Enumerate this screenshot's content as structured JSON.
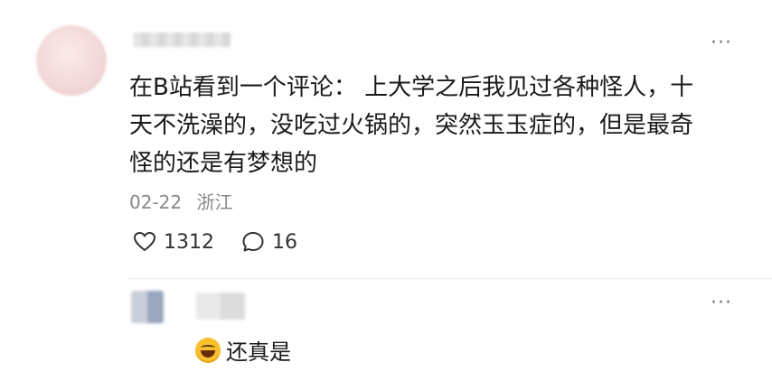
{
  "comment": {
    "text_line1": "在B站看到一个评论：  上大学之后我见过各种怪人，十",
    "text_line2": "天不洗澡的，没吃过火锅的，突然玉玉症的，但是最奇",
    "text_line3": "怪的还是有梦想的",
    "date": "02-22",
    "location": "浙江",
    "like_count": "1312",
    "reply_count": "16",
    "more_label": "···"
  },
  "reply": {
    "emoji": "laughing-tears-emoji",
    "text": "还真是",
    "more_label": "···"
  },
  "icons": {
    "like": "heart-icon",
    "comment": "comment-bubble-icon",
    "more": "more-dots-icon"
  }
}
